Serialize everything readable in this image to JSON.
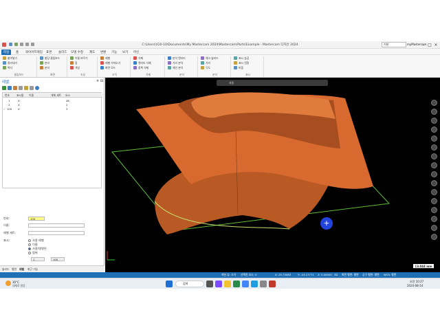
{
  "window": {
    "title": "C:\\Users\\X10-10\\Documents\\My Mastercam 2024\\Mastercam\\Parts\\Example - Mastercam 디자인 2024",
    "search_placeholder": "기본",
    "user": "myMastercam"
  },
  "menu": [
    "파일",
    "홈",
    "와이어프레임",
    "표면",
    "솔리드",
    "모델 수정",
    "제도",
    "변환",
    "기능",
    "보기",
    "머신"
  ],
  "menu_active": 1,
  "ribbon": {
    "groups": [
      {
        "label": "클립보드",
        "items": [
          "붙여넣기",
          "잘라내기",
          "복사"
        ]
      },
      {
        "label": "화면",
        "items": [
          "할당 클립보드",
          "분리",
          "분석"
        ]
      },
      {
        "label": "속성",
        "items": [
          "이름 바꾸기",
          "점",
          "색상"
        ]
      },
      {
        "label": "조직",
        "items": [
          "레벨",
          "레벨 가져오기",
          "화면 모드"
        ]
      },
      {
        "label": "삭제",
        "items": [
          "삭제",
          "엔티티 삭제",
          "중복 삭제"
        ]
      },
      {
        "label": "분석",
        "items": [
          "분석 엔티티",
          "거리 분석",
          "체인 분석"
        ]
      },
      {
        "label": "분석",
        "items": [
          "체크 솔리드",
          "거리",
          "각도"
        ]
      },
      {
        "label": "표시",
        "items": [
          "표시 숨김",
          "표시 전환",
          "비움"
        ]
      }
    ]
  },
  "panel": {
    "title": "레벨",
    "columns": [
      "번호",
      "표시됨",
      "이름",
      "개체 세트",
      "요소"
    ],
    "rows": [
      {
        "num": "1",
        "visible": "X",
        "name": "",
        "set": "",
        "count": "46"
      },
      {
        "num": "2",
        "visible": "X",
        "name": "",
        "set": "",
        "count": "2"
      },
      {
        "num": "100",
        "visible": "X",
        "name": "",
        "set": "",
        "count": "3"
      }
    ],
    "fields": {
      "number_label": "번호:",
      "number_value": "100",
      "name_label": "이름:",
      "set_label": "레벨 세트:",
      "show_label": "표시:",
      "radio1": "사용 레벨",
      "radio2": "이름",
      "radio3": "사용/명명된",
      "radio4": "범위",
      "range_from": "1",
      "range_to": "100"
    },
    "bottom_tabs": [
      "솔리드",
      "평면",
      "레벨",
      "최근 기능"
    ]
  },
  "viewport": {
    "toolbar_label": "자동",
    "scale": "13.044 mm",
    "colors": {
      "background": "#000000",
      "surface": "#d86a2f",
      "plane": "#5fbf3a"
    }
  },
  "status": {
    "section": "섹션 뷰: 끄기",
    "selected": "선택된 요소: 0",
    "x": "X: 25.73083",
    "y": "Y: -43.17771",
    "z": "Z: 0.00000",
    "mode": "3D",
    "plane": "화면 평면: 평면",
    "toolplane": "공구 평면: 평면",
    "wcs": "WCS: 평면"
  },
  "taskbar": {
    "weather": "30°C",
    "weather_desc": "대체로 맑음",
    "search": "검색",
    "time": "오전 10:27",
    "date": "2024-08-14"
  }
}
